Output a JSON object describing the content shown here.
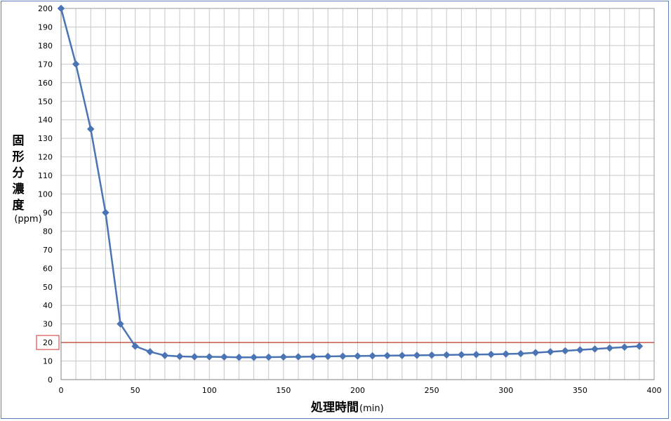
{
  "chart_data": {
    "type": "line",
    "title": "",
    "xlabel": "処理時間",
    "xlabel_unit": "(min)",
    "ylabel": "固形分濃度",
    "ylabel_unit": "(ppm)",
    "xlim": [
      0,
      400
    ],
    "ylim": [
      0,
      200
    ],
    "x_ticks": [
      0,
      50,
      100,
      150,
      200,
      250,
      300,
      350,
      400
    ],
    "y_ticks": [
      0,
      10,
      20,
      30,
      40,
      50,
      60,
      70,
      80,
      90,
      100,
      110,
      120,
      130,
      140,
      150,
      160,
      170,
      180,
      190,
      200
    ],
    "x_minor_step": 10,
    "grid": true,
    "series": [
      {
        "color": "#4a74b4",
        "marker": "diamond",
        "x": [
          0,
          10,
          20,
          30,
          40,
          50,
          60,
          70,
          80,
          90,
          100,
          110,
          120,
          130,
          140,
          150,
          160,
          170,
          180,
          190,
          200,
          210,
          220,
          230,
          240,
          250,
          260,
          270,
          280,
          290,
          300,
          310,
          320,
          330,
          340,
          350,
          360,
          370,
          380,
          390
        ],
        "y": [
          200,
          170,
          135,
          90,
          30,
          18,
          15,
          13,
          12.5,
          12.3,
          12.3,
          12.2,
          12,
          12,
          12.1,
          12.2,
          12.3,
          12.4,
          12.5,
          12.6,
          12.7,
          12.8,
          12.9,
          13,
          13.1,
          13.2,
          13.3,
          13.4,
          13.5,
          13.6,
          13.8,
          14,
          14.5,
          15,
          15.5,
          16,
          16.5,
          17,
          17.5,
          18
        ]
      }
    ],
    "reference_line": {
      "y": 20,
      "color": "#c0392b",
      "highlight_label": "20"
    }
  }
}
